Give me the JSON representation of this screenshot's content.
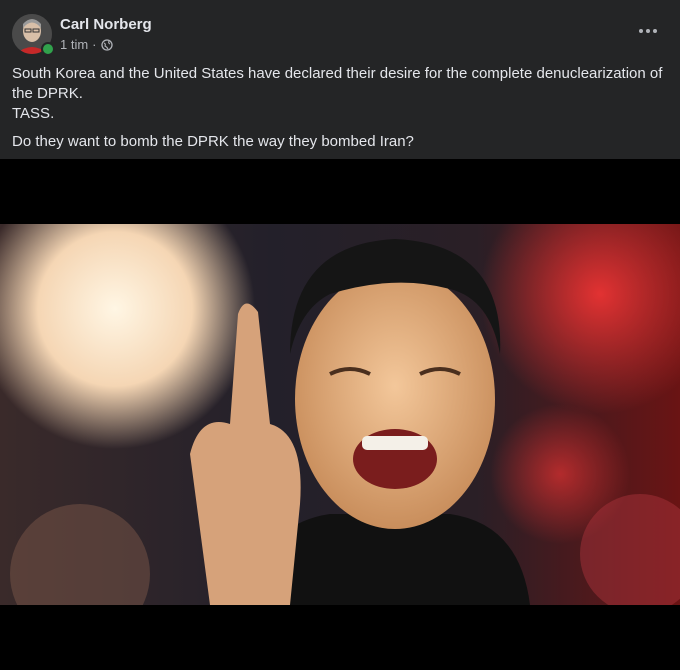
{
  "post": {
    "author": "Carl Norberg",
    "time": "1 tim",
    "separator": "·",
    "privacy_icon": "globe-icon",
    "more_icon": "more-options-icon",
    "text_line1": "South Korea and the United States have declared their desire for the complete denuclearization of the DPRK.",
    "text_line2": "TASS.",
    "text_line3": "Do they want to bomb the DPRK the way they bombed Iran?"
  },
  "colors": {
    "background": "#242526",
    "text_primary": "#e4e6eb",
    "text_secondary": "#b0b3b8",
    "online": "#31a24c"
  }
}
